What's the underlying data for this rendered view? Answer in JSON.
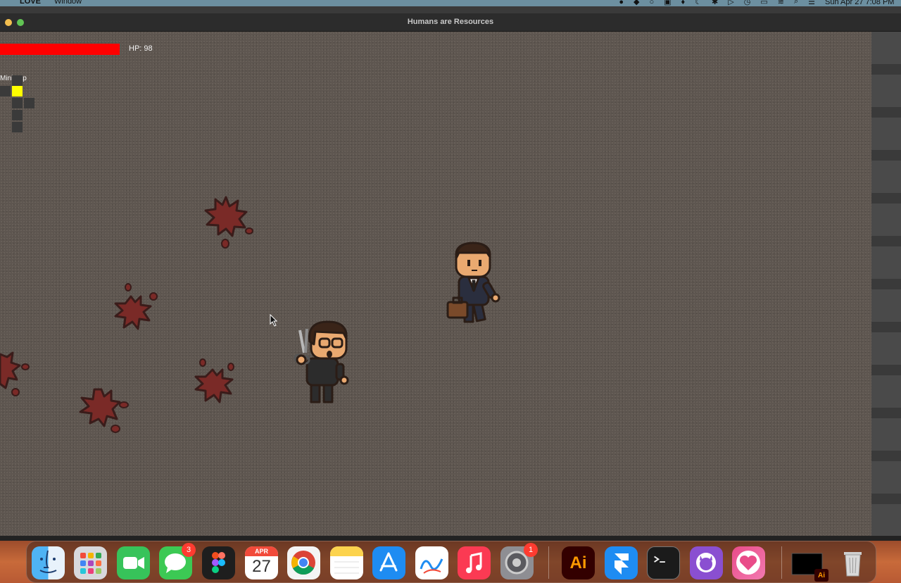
{
  "menubar": {
    "app_name": "LOVE",
    "menu_window": "Window",
    "clock": "Sun Apr 27  7:08 PM"
  },
  "window": {
    "title": "Humans are Resources"
  },
  "hud": {
    "hp_label": "HP: 98",
    "hp_value": 98,
    "hp_color": "#ff0000",
    "minimap_label": "Minimap",
    "minimap_active_color": "#ffff00"
  },
  "characters": [
    {
      "name": "player-office-worker-with-scissors",
      "description_role": "player"
    },
    {
      "name": "enemy-office-worker-with-briefcase",
      "description_role": "enemy"
    }
  ],
  "dock": {
    "apps": [
      {
        "name": "Finder",
        "icon": "finder-icon"
      },
      {
        "name": "Launchpad",
        "icon": "launchpad-icon"
      },
      {
        "name": "FaceTime",
        "icon": "facetime-icon"
      },
      {
        "name": "Messages",
        "icon": "messages-icon",
        "badge": "3"
      },
      {
        "name": "Figma",
        "icon": "figma-icon"
      },
      {
        "name": "Calendar",
        "icon": "calendar-icon",
        "month": "APR",
        "day": "27"
      },
      {
        "name": "Chrome",
        "icon": "chrome-icon"
      },
      {
        "name": "Notes",
        "icon": "notes-icon"
      },
      {
        "name": "App Store",
        "icon": "app-store-icon"
      },
      {
        "name": "Freeform",
        "icon": "freeform-icon"
      },
      {
        "name": "Music",
        "icon": "music-icon"
      },
      {
        "name": "System Settings",
        "icon": "settings-icon",
        "badge": "1"
      },
      {
        "name": "Illustrator",
        "icon": "illustrator-icon",
        "text": "Ai"
      },
      {
        "name": "Framer",
        "icon": "framer-icon"
      },
      {
        "name": "Terminal",
        "icon": "terminal-icon"
      },
      {
        "name": "GitHub Desktop",
        "icon": "github-icon"
      },
      {
        "name": "Love",
        "icon": "love-icon"
      },
      {
        "name": "Illustrator Window",
        "icon": "window-thumbnail-icon",
        "text": "Ai"
      },
      {
        "name": "Trash",
        "icon": "trash-icon"
      }
    ]
  }
}
